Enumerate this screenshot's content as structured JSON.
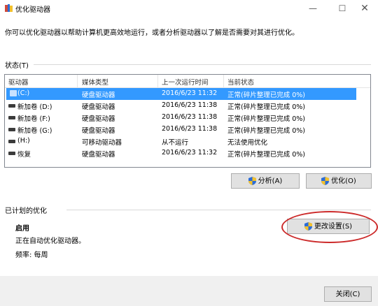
{
  "window": {
    "title": "优化驱动器",
    "minimize": "—",
    "maximize": "☐",
    "close": "✕"
  },
  "intro": "你可以优化驱动器以帮助计算机更高效地运行，或者分析驱动器以了解是否需要对其进行优化。",
  "status_section": {
    "label": "状态(T)",
    "columns": [
      "驱动器",
      "媒体类型",
      "上一次运行时间",
      "当前状态"
    ],
    "rows": [
      {
        "drive": "(C:)",
        "media": "硬盘驱动器",
        "last_run": "2016/6/23 11:32",
        "status": "正常(碎片整理已完成 0%)",
        "selected": true
      },
      {
        "drive": "新加卷 (D:)",
        "media": "硬盘驱动器",
        "last_run": "2016/6/23 11:38",
        "status": "正常(碎片整理已完成 0%)"
      },
      {
        "drive": "新加卷 (F:)",
        "media": "硬盘驱动器",
        "last_run": "2016/6/23 11:38",
        "status": "正常(碎片整理已完成 0%)"
      },
      {
        "drive": "新加卷 (G:)",
        "media": "硬盘驱动器",
        "last_run": "2016/6/23 11:38",
        "status": "正常(碎片整理已完成 0%)"
      },
      {
        "drive": "(H:)",
        "media": "可移动驱动器",
        "last_run": "从不运行",
        "status": "无法使用优化"
      },
      {
        "drive": "恢复",
        "media": "硬盘驱动器",
        "last_run": "2016/6/23 11:32",
        "status": "正常(碎片整理已完成 0%)"
      }
    ],
    "analyze_label": "分析(A)",
    "optimize_label": "优化(O)"
  },
  "scheduled": {
    "label": "已计划的优化",
    "status": "启用",
    "description": "正在自动优化驱动器。",
    "frequency": "频率: 每周",
    "change_settings_label": "更改设置(S)"
  },
  "footer": {
    "close_label": "关闭(C)"
  },
  "colors": {
    "selection": "#3399ff",
    "annotation_ring": "#cc2a2a",
    "shield_blue": "#2b6cd8",
    "shield_yellow": "#f2c12e"
  }
}
